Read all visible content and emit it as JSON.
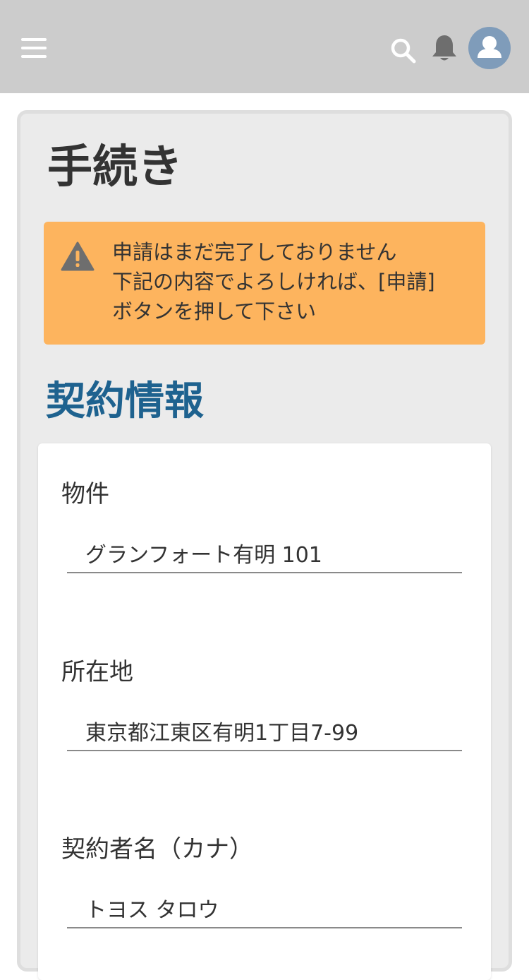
{
  "header": {
    "menu_icon": "hamburger-menu-icon",
    "search_icon": "search-icon",
    "notification_icon": "bell-icon",
    "avatar_icon": "user-avatar-icon",
    "colors": {
      "bar": "#cccccc",
      "avatar": "#7f9cba"
    }
  },
  "page": {
    "title": "手続き"
  },
  "alert": {
    "icon": "warning-icon",
    "lines": [
      "申請はまだ完了しておりません",
      "下記の内容でよろしければ、[申請]",
      "ボタンを押して下さい"
    ],
    "color": "#fdb45e"
  },
  "section": {
    "title": "契約情報",
    "color": "#1e628f"
  },
  "fields": [
    {
      "label": "物件",
      "value": "グランフォート有明 101"
    },
    {
      "label": "所在地",
      "value": "東京都江東区有明1丁目7-99"
    },
    {
      "label": "契約者名（カナ）",
      "value": "トヨス タロウ"
    }
  ]
}
